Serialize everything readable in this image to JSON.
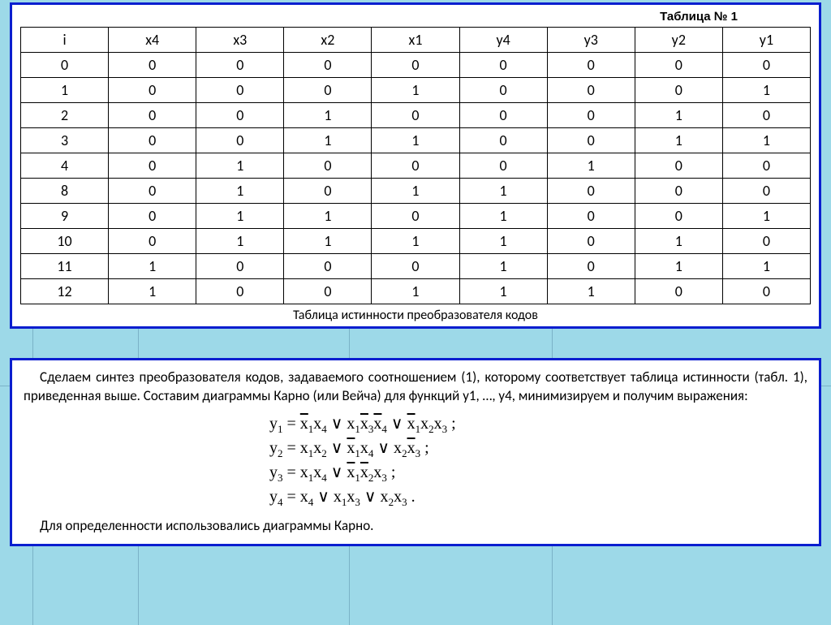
{
  "table": {
    "title": "Таблица № 1",
    "headers": [
      "i",
      "x4",
      "x3",
      "x2",
      "x1",
      "y4",
      "y3",
      "y2",
      "y1"
    ],
    "rows": [
      [
        "0",
        "0",
        "0",
        "0",
        "0",
        "0",
        "0",
        "0",
        "0"
      ],
      [
        "1",
        "0",
        "0",
        "0",
        "1",
        "0",
        "0",
        "0",
        "1"
      ],
      [
        "2",
        "0",
        "0",
        "1",
        "0",
        "0",
        "0",
        "1",
        "0"
      ],
      [
        "3",
        "0",
        "0",
        "1",
        "1",
        "0",
        "0",
        "1",
        "1"
      ],
      [
        "4",
        "0",
        "1",
        "0",
        "0",
        "0",
        "1",
        "0",
        "0"
      ],
      [
        "8",
        "0",
        "1",
        "0",
        "1",
        "1",
        "0",
        "0",
        "0"
      ],
      [
        "9",
        "0",
        "1",
        "1",
        "0",
        "1",
        "0",
        "0",
        "1"
      ],
      [
        "10",
        "0",
        "1",
        "1",
        "1",
        "1",
        "0",
        "1",
        "0"
      ],
      [
        "11",
        "1",
        "0",
        "0",
        "0",
        "1",
        "0",
        "1",
        "1"
      ],
      [
        "12",
        "1",
        "0",
        "0",
        "1",
        "1",
        "1",
        "0",
        "0"
      ]
    ],
    "caption": "Таблица истинности преобразователя кодов"
  },
  "paragraph1": "Сделаем синтез преобразователя кодов, задаваемого соотношением (1), которому соответствует таблица истинности (табл. 1), приведенная выше. Составим диаграммы Карно (или Вейча) для функций y1, …, y4, минимизируем и получим выражения:",
  "formulas": {
    "y1": "y₁ = x̄₁x₄ ∨ x₁x̄₃x̄₄ ∨ x̄₁x₂x₃ ;",
    "y2": "y₂ = x₁x₂ ∨ x̄₁x₄ ∨ x₂x̄₃ ;",
    "y3": "y₃ = x₁x₄ ∨ x̄₁x̄₂x₃ ;",
    "y4": "y₄ = x₄ ∨ x₁x₃ ∨ x₂x₃ ."
  },
  "paragraph2": "Для определенности использовались диаграммы Карно.",
  "bg_label": "10k"
}
